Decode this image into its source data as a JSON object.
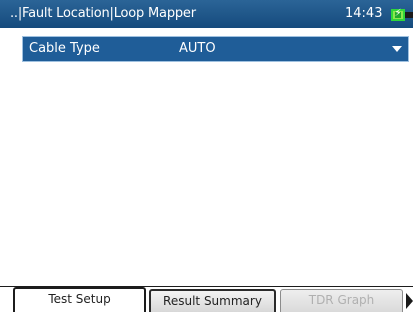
{
  "header": {
    "title": "..|Fault Location|Loop Mapper",
    "time": "14:43"
  },
  "settings": {
    "cable_type_label": "Cable Type",
    "cable_type_value": "AUTO"
  },
  "tabs": [
    {
      "label": "Test Setup",
      "state": "active"
    },
    {
      "label": "Result Summary",
      "state": "normal"
    },
    {
      "label": "TDR Graph",
      "state": "disabled"
    }
  ],
  "colors": {
    "titlebar": "#1f5d98",
    "selected_row": "#1f5d98",
    "battery": "#2fd63a",
    "disabled_text": "#b0b0b0"
  },
  "icons": {
    "battery": "battery-charging-icon",
    "dropdown": "chevron-down-icon",
    "scroll": "scroll-right-icon"
  }
}
